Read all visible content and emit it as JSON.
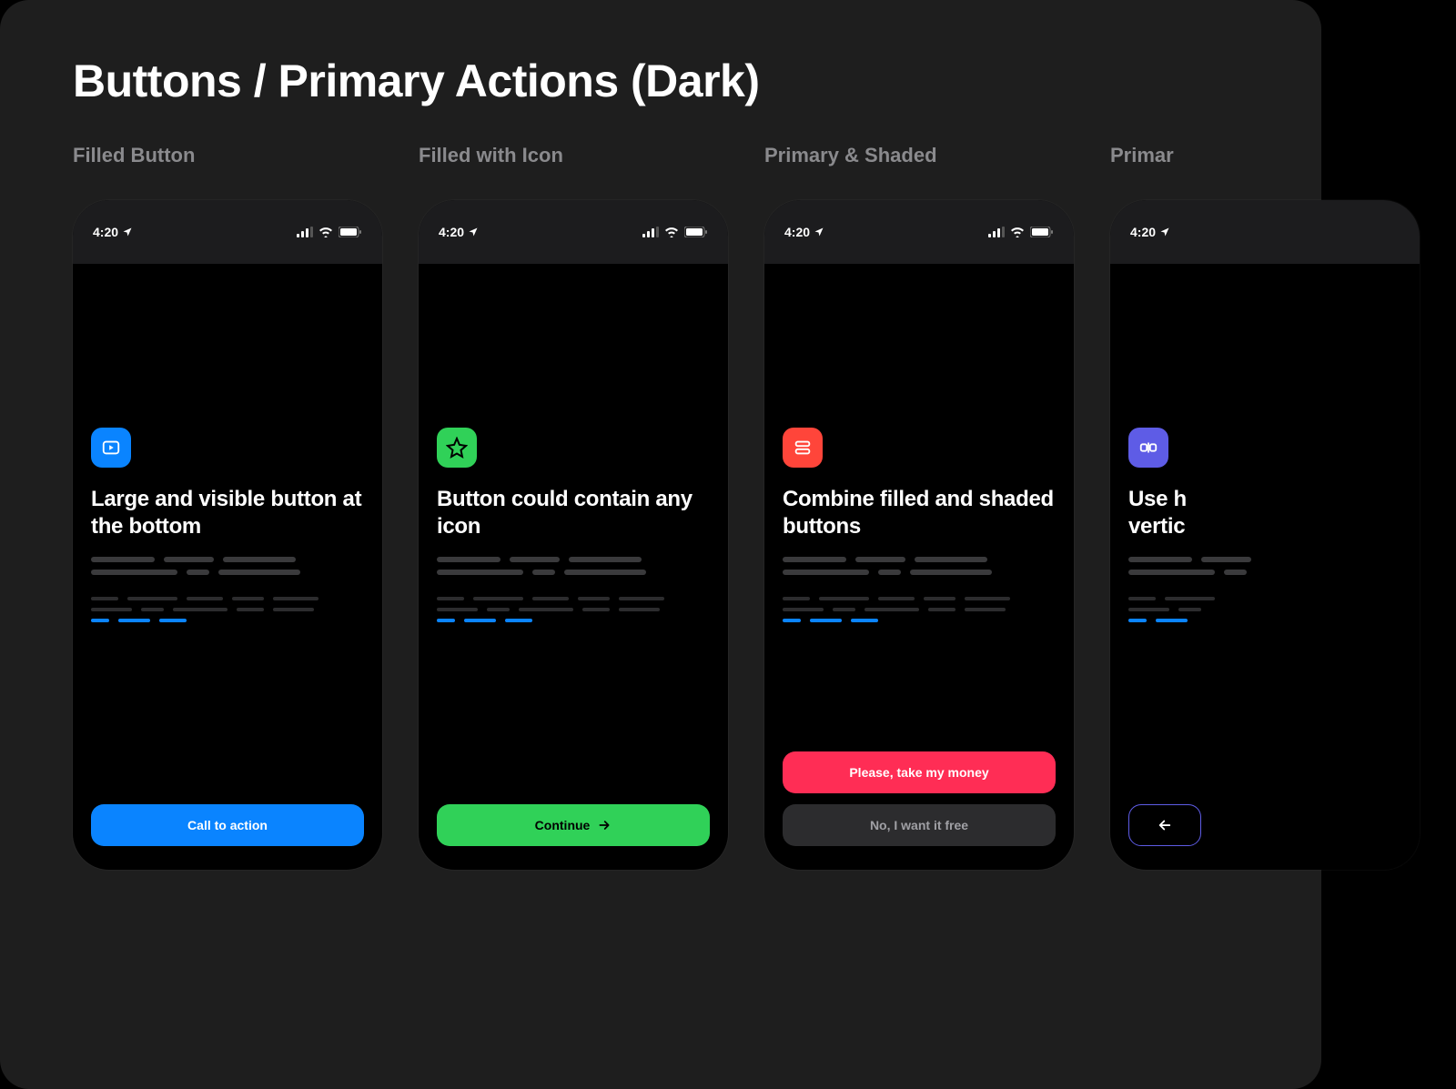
{
  "page_title": "Buttons / Primary Actions (Dark)",
  "status_time": "4:20",
  "colors": {
    "blue": "#0a84ff",
    "green": "#30d158",
    "red": "#ff453a",
    "pink": "#ff2d55",
    "indigo": "#5e5ce6",
    "shaded": "#2c2c2e"
  },
  "columns": [
    {
      "title": "Filled Button",
      "icon": "play",
      "icon_bg": "blue",
      "heading": "Large and visible button at the bottom",
      "buttons": [
        {
          "label": "Call to action",
          "bg": "blue",
          "text": "#ffffff",
          "icon": null,
          "outline": false
        }
      ]
    },
    {
      "title": "Filled with Icon",
      "icon": "star",
      "icon_bg": "green",
      "heading": "Button could contain any icon",
      "buttons": [
        {
          "label": "Continue",
          "bg": "green",
          "text": "#000000",
          "icon": "arrow-right",
          "outline": false
        }
      ]
    },
    {
      "title": "Primary & Shaded",
      "icon": "stack",
      "icon_bg": "red",
      "heading": "Combine filled and shaded buttons",
      "buttons": [
        {
          "label": "Please, take my money",
          "bg": "pink",
          "text": "#ffffff",
          "icon": null,
          "outline": false
        },
        {
          "label": "No, I want it free",
          "bg": "shaded",
          "text": "#a0a0a5",
          "icon": null,
          "outline": false
        }
      ]
    },
    {
      "title": "Primar",
      "icon": "split",
      "icon_bg": "indigo",
      "heading": "Use h\nvertic",
      "buttons": [
        {
          "label": "",
          "bg": "transparent",
          "text": "#ffffff",
          "icon": "arrow-left",
          "outline": true
        }
      ]
    }
  ]
}
